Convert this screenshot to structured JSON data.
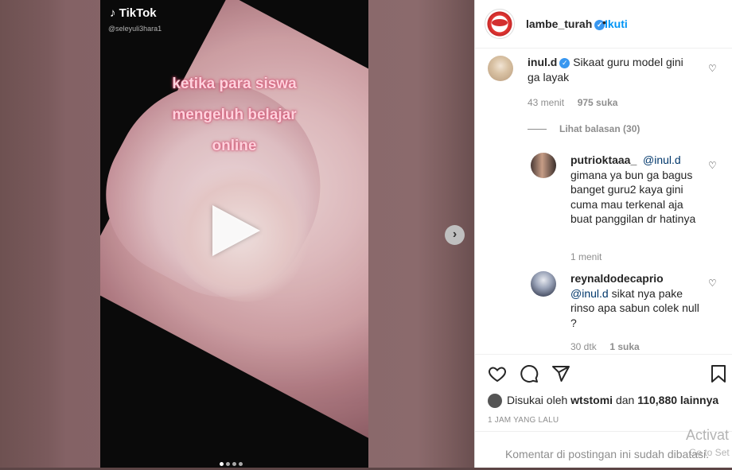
{
  "video": {
    "tiktok_logo": "TikTok",
    "tiktok_handle": "@seleyuli3hara1",
    "caption_lines": [
      "ketika para siswa",
      "mengeluh belajar",
      "online"
    ],
    "slide_count": 4,
    "active_slide": 1
  },
  "post": {
    "username": "lambe_turah",
    "separator": "•",
    "follow_label": "Ikuti"
  },
  "comments": [
    {
      "user": "inul.d",
      "verified": true,
      "text": "Sikaat guru model gini ga layak",
      "time": "43 menit",
      "likes": "975 suka"
    },
    {
      "view_replies": "Lihat balasan (30)"
    },
    {
      "user": "putrioktaaa_",
      "mention": "@inul.d",
      "text": "gimana ya bun ga bagus banget guru2 kaya gini cuma mau terkenal aja buat panggilan dr hatinya",
      "time": "1 menit"
    },
    {
      "user": "reynaldodecaprio",
      "mention": "@inul.d",
      "text": "sikat nya pake rinso apa sabun colek null ?",
      "time": "30 dtk",
      "likes": "1 suka"
    }
  ],
  "likes": {
    "prefix": "Disukai oleh",
    "user": "wtstomi",
    "middle": "dan",
    "count": "110,880 lainnya"
  },
  "time_ago": "1 JAM YANG LALU",
  "comment_disabled": "Komentar di postingan ini sudah dibatasi.",
  "watermark": {
    "line1": "Activat",
    "line2": "Go to Set"
  },
  "icons": {
    "heart": "heart-icon",
    "comment": "comment-icon",
    "share": "share-icon",
    "save": "bookmark-icon"
  }
}
